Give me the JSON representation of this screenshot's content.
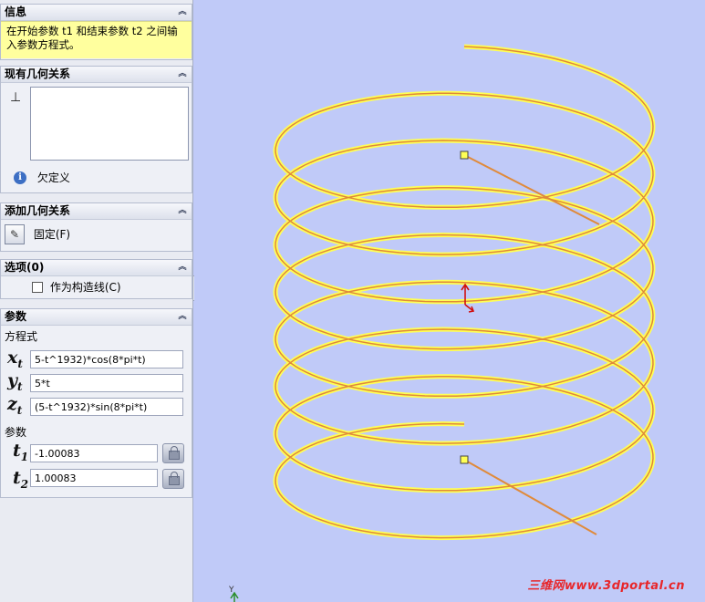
{
  "message": {
    "title": "信息",
    "text": "在开始参数 t1 和结束参数 t2 之间输入参数方程式。"
  },
  "existing_relations": {
    "title": "现有几何关系",
    "status": "欠定义"
  },
  "add_relations": {
    "title": "添加几何关系",
    "fix_label": "固定(F)"
  },
  "options": {
    "title": "选项(0)",
    "construction_label": "作为构造线(C)",
    "construction_checked": false
  },
  "parameters": {
    "title": "参数",
    "equation_label": "方程式",
    "params_label": "参数",
    "x_equation": "5-t^1932)*cos(8*pi*t)",
    "y_equation": "5*t",
    "z_equation": "(5-t^1932)*sin(8*pi*t)",
    "t1_value": "-1.00083",
    "t2_value": "1.00083"
  },
  "symbols": {
    "x": "x",
    "y": "y",
    "z": "z",
    "t": "t",
    "sub_t": "t",
    "sub_1": "1",
    "sub_2": "2"
  },
  "triad_label": "Y",
  "watermark": "三维网www.3dportal.cn",
  "colors": {
    "viewport_bg": "#c0caf8",
    "curve_outer": "#ffff55",
    "curve_inner": "#e08a3a",
    "message_bg": "#ffff9e"
  },
  "icons": [
    "collapse-icon",
    "perpendicular-icon",
    "info-icon",
    "fix-icon",
    "lock-icon",
    "origin-arrow-icon"
  ]
}
